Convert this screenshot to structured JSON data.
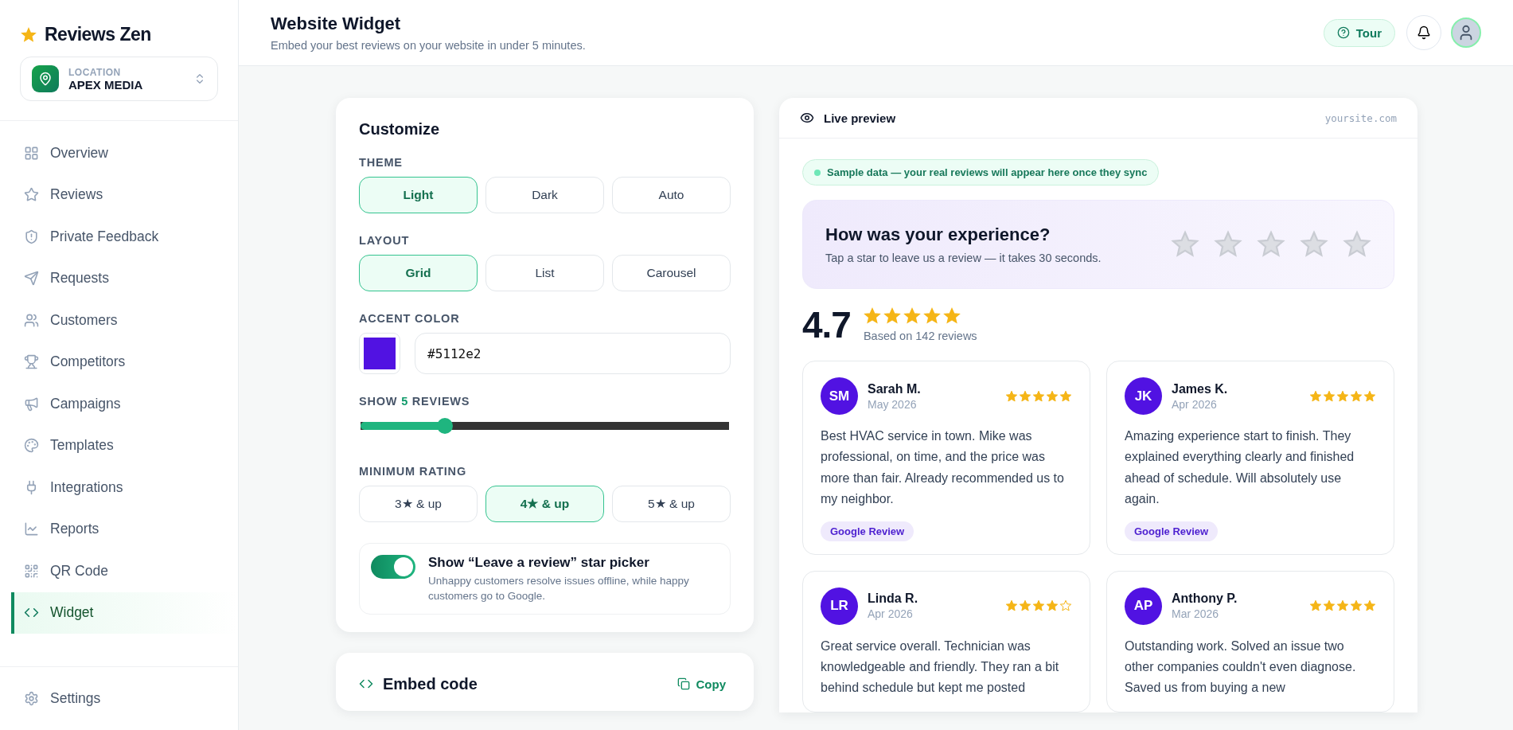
{
  "brand": {
    "name": "Reviews Zen"
  },
  "location": {
    "label": "LOCATION",
    "name": "APEX MEDIA"
  },
  "nav": [
    {
      "kind": "overview",
      "label": "Overview",
      "selected": false
    },
    {
      "kind": "reviews",
      "label": "Reviews",
      "selected": false
    },
    {
      "kind": "feedback",
      "label": "Private Feedback",
      "selected": false
    },
    {
      "kind": "requests",
      "label": "Requests",
      "selected": false
    },
    {
      "kind": "customers",
      "label": "Customers",
      "selected": false
    },
    {
      "kind": "competitors",
      "label": "Competitors",
      "selected": false
    },
    {
      "kind": "campaigns",
      "label": "Campaigns",
      "selected": false
    },
    {
      "kind": "templates",
      "label": "Templates",
      "selected": false
    },
    {
      "kind": "integrations",
      "label": "Integrations",
      "selected": false
    },
    {
      "kind": "reports",
      "label": "Reports",
      "selected": false
    },
    {
      "kind": "qr",
      "label": "QR Code",
      "selected": false
    },
    {
      "kind": "widget",
      "label": "Widget",
      "selected": true
    }
  ],
  "settings": {
    "label": "Settings"
  },
  "header": {
    "title": "Website Widget",
    "subtitle": "Embed your best reviews on your website in under 5 minutes.",
    "tour": "Tour"
  },
  "customize": {
    "title": "Customize",
    "theme": {
      "label": "THEME",
      "options": [
        {
          "label": "Light",
          "selected": true
        },
        {
          "label": "Dark",
          "selected": false
        },
        {
          "label": "Auto",
          "selected": false
        }
      ]
    },
    "layout": {
      "label": "LAYOUT",
      "options": [
        {
          "label": "Grid",
          "selected": true
        },
        {
          "label": "List",
          "selected": false
        },
        {
          "label": "Carousel",
          "selected": false
        }
      ]
    },
    "accent": {
      "label": "ACCENT COLOR",
      "value": "#5112e2",
      "color": "#5112e2"
    },
    "show": {
      "label": "SHOW **5** REVIEWS",
      "level": 0.23
    },
    "rating": {
      "label": "MINIMUM RATING",
      "options": [
        {
          "label": "3★ & up",
          "selected": false
        },
        {
          "label": "4★ & up",
          "selected": true
        },
        {
          "label": "5★ & up",
          "selected": false
        }
      ]
    },
    "picker": {
      "on": true,
      "title": "Show “Leave a review” star picker",
      "description": "Unhappy customers resolve issues offline, while happy customers go to Google."
    }
  },
  "embed": {
    "title": "Embed code",
    "copy": "Copy"
  },
  "preview": {
    "title": "Live preview",
    "site": "yoursite.com",
    "notice": "Sample data — your real reviews will appear here once they sync",
    "prompt": {
      "title": "How was your experience?",
      "text": "Tap a star to leave us a review — it takes 30 seconds.",
      "stars": 0
    },
    "summary": {
      "score": "4.7",
      "stars": 5,
      "text": "Based on 142 reviews"
    },
    "reviews": [
      {
        "initials": "SM",
        "name": "Sarah M.",
        "date": "May 2026",
        "stars": 5,
        "text": "Best HVAC service in town. Mike was professional, on time, and the price was more than fair. Already recommended us to my neighbor.",
        "source": "Google Review"
      },
      {
        "initials": "JK",
        "name": "James K.",
        "date": "Apr 2026",
        "stars": 5,
        "text": "Amazing experience start to finish. They explained everything clearly and finished ahead of schedule. Will absolutely use again.",
        "source": "Google Review"
      },
      {
        "initials": "LR",
        "name": "Linda R.",
        "date": "Apr 2026",
        "stars": 4,
        "text": "Great service overall. Technician was knowledgeable and friendly. They ran a bit behind schedule but kept me posted"
      },
      {
        "initials": "AP",
        "name": "Anthony P.",
        "date": "Mar 2026",
        "stars": 5,
        "text": "Outstanding work. Solved an issue two other companies couldn't even diagnose. Saved us from buying a new"
      }
    ]
  }
}
